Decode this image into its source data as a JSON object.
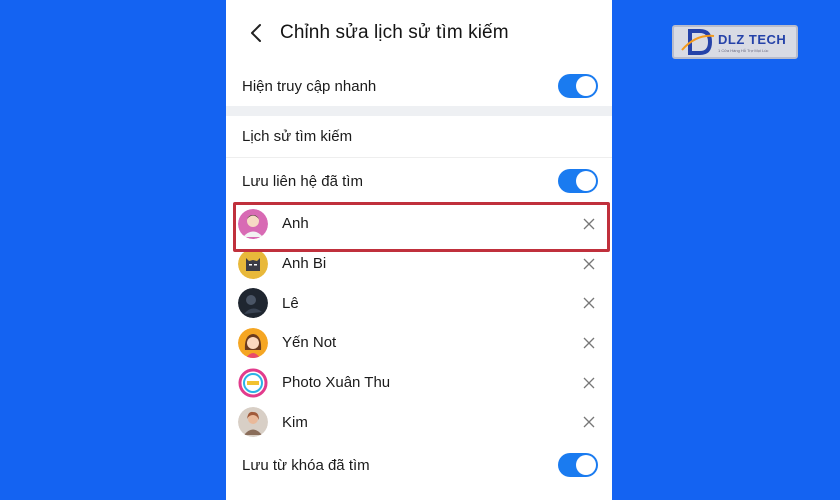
{
  "header": {
    "title": "Chỉnh sửa lịch sử tìm kiếm"
  },
  "quick_access": {
    "label": "Hiện truy cập nhanh",
    "enabled": true
  },
  "history_section": {
    "title": "Lịch sử tìm kiếm"
  },
  "save_contacts": {
    "label": "Lưu liên hệ đã tìm",
    "enabled": true
  },
  "contacts": [
    {
      "name": "Anh",
      "avatar": "man-avatar",
      "highlighted": true
    },
    {
      "name": "Anh Bi",
      "avatar": "batman-avatar"
    },
    {
      "name": "Lê",
      "avatar": "dark-photo-avatar"
    },
    {
      "name": "Yến Not",
      "avatar": "woman-cartoon-avatar"
    },
    {
      "name": "Photo Xuân Thu",
      "avatar": "logo-avatar"
    },
    {
      "name": "Kim",
      "avatar": "photo-avatar"
    }
  ],
  "save_keywords": {
    "label": "Lưu từ khóa đã tìm",
    "enabled": true
  },
  "watermark": {
    "name": "DLZ TECH",
    "tagline": "1 Cửa Hàng Hỗ Trợ Mọi Lúc"
  },
  "colors": {
    "accent": "#1a7bf0",
    "background": "#1463f2",
    "highlight": "#c0303c"
  }
}
